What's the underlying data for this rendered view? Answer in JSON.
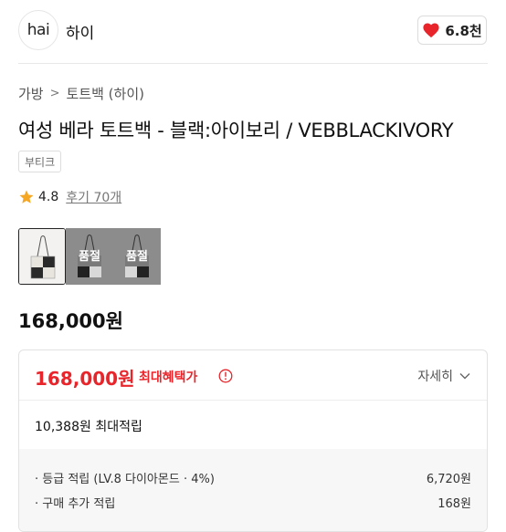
{
  "header": {
    "brand_logo_text": "hai",
    "brand_name": "하이",
    "like_count": "6.8천"
  },
  "breadcrumb": {
    "items": [
      "가방",
      "토트백 (하이)"
    ],
    "separator": ">"
  },
  "product": {
    "title": "여성 베라 토트백 - 블랙:아이보리 / VEBBLACKIVORY",
    "tag": "부티크",
    "rating": "4.8",
    "reviews": "후기 70개",
    "price": "168,000원"
  },
  "thumbnails": [
    {
      "soldout": false,
      "label": ""
    },
    {
      "soldout": true,
      "label": "품절"
    },
    {
      "soldout": true,
      "label": "품절"
    }
  ],
  "benefit": {
    "price": "168,000원",
    "label": "최대혜택가",
    "detail_label": "자세히",
    "points_total": "10,388원 최대적립",
    "rows": [
      {
        "label": "· 등급 적립 (LV.8 다이아몬드 · 4%)",
        "value": "6,720원"
      },
      {
        "label": "· 구매 추가 적립",
        "value": "168원"
      }
    ]
  },
  "colors": {
    "accent": "#e8252b",
    "heart": "#e8252b",
    "star": "#f5a623"
  },
  "icons": {
    "like": "heart-icon",
    "rating": "star-icon",
    "info": "info-icon",
    "detail": "chevron-down-icon",
    "breadcrumb": "chevron-right-icon"
  }
}
